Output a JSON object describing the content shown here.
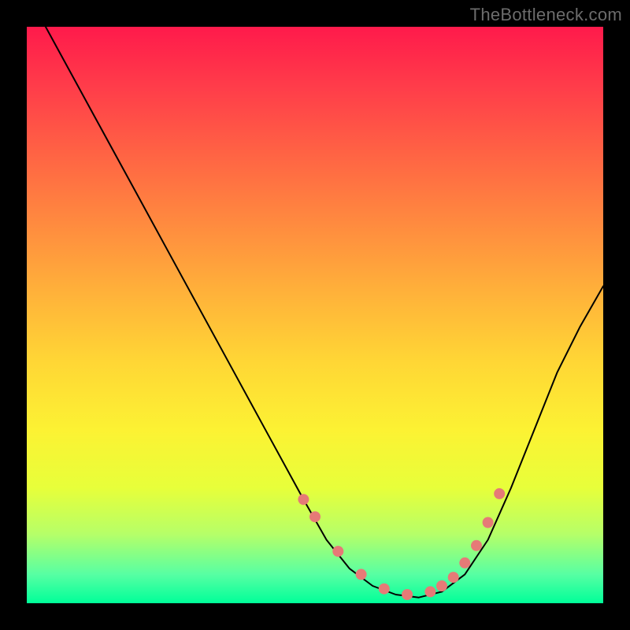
{
  "watermark": "TheBottleneck.com",
  "chart_data": {
    "type": "line",
    "title": "",
    "xlabel": "",
    "ylabel": "",
    "xlim": [
      0,
      100
    ],
    "ylim": [
      0,
      100
    ],
    "series": [
      {
        "name": "curve",
        "x": [
          0,
          6,
          12,
          18,
          24,
          30,
          36,
          42,
          48,
          52,
          56,
          60,
          64,
          68,
          72,
          76,
          80,
          84,
          88,
          92,
          96,
          100
        ],
        "values": [
          106,
          95,
          84,
          73,
          62,
          51,
          40,
          29,
          18,
          11,
          6,
          3,
          1.5,
          1,
          2,
          5,
          11,
          20,
          30,
          40,
          48,
          55
        ]
      }
    ],
    "markers": {
      "name": "dots",
      "x": [
        48,
        50,
        54,
        58,
        62,
        66,
        70,
        72,
        74,
        76,
        78,
        80,
        82
      ],
      "values": [
        18,
        15,
        9,
        5,
        2.5,
        1.5,
        2,
        3,
        4.5,
        7,
        10,
        14,
        19
      ]
    }
  }
}
